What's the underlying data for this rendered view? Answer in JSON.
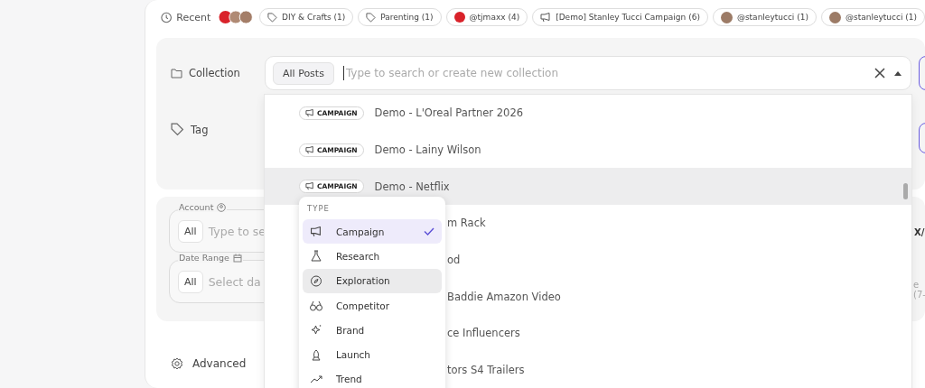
{
  "recent": {
    "label": "Recent",
    "chips": [
      {
        "kind": "tag",
        "label": "DIY & Crafts (1)"
      },
      {
        "kind": "tag",
        "label": "Parenting (1)"
      },
      {
        "kind": "brand",
        "label": "@tjmaxx (4)"
      },
      {
        "kind": "campaign",
        "label": "[Demo] Stanley Tucci Campaign (6)"
      },
      {
        "kind": "person",
        "label": "@stanleytucci (1)"
      },
      {
        "kind": "person",
        "label": "@stanleytucci (1)"
      }
    ]
  },
  "collection": {
    "label": "Collection",
    "scope": "All Posts",
    "placeholder": "Type to search or create new collection"
  },
  "tag": {
    "label": "Tag"
  },
  "collection_options": [
    {
      "badge": "CAMPAIGN",
      "name": "Demo - L'Oreal Partner 2026",
      "hovered": false
    },
    {
      "badge": "CAMPAIGN",
      "name": "Demo - Lainy Wilson",
      "hovered": false
    },
    {
      "badge": "CAMPAIGN",
      "name": "Demo - Netflix",
      "hovered": true
    },
    {
      "name": "m Rack",
      "hovered": false
    },
    {
      "name": "od",
      "hovered": false
    },
    {
      "name": "Baddie Amazon Video",
      "hovered": false
    },
    {
      "name": "ce Influencers",
      "hovered": false
    },
    {
      "name": "tors S4 Trailers",
      "hovered": false
    }
  ],
  "type_menu": {
    "heading": "TYPE",
    "items": [
      {
        "kind": "campaign",
        "label": "Campaign",
        "selected": true,
        "hovered": false
      },
      {
        "kind": "research",
        "label": "Research",
        "selected": false,
        "hovered": false
      },
      {
        "kind": "exploration",
        "label": "Exploration",
        "selected": false,
        "hovered": true
      },
      {
        "kind": "competitor",
        "label": "Competitor",
        "selected": false,
        "hovered": false
      },
      {
        "kind": "brand",
        "label": "Brand",
        "selected": false,
        "hovered": false
      },
      {
        "kind": "launch",
        "label": "Launch",
        "selected": false,
        "hovered": false
      },
      {
        "kind": "trend",
        "label": "Trend",
        "selected": false,
        "hovered": false
      }
    ]
  },
  "filters": [
    {
      "kind": "account",
      "label": "Account",
      "scope": "All",
      "placeholder": "Type to se"
    },
    {
      "kind": "date",
      "label": "Date Range",
      "scope": "All",
      "placeholder": "Select da"
    }
  ],
  "advanced": {
    "label": "Advanced"
  },
  "background_table": {
    "column_header": "X/",
    "cell": "e (7-"
  }
}
